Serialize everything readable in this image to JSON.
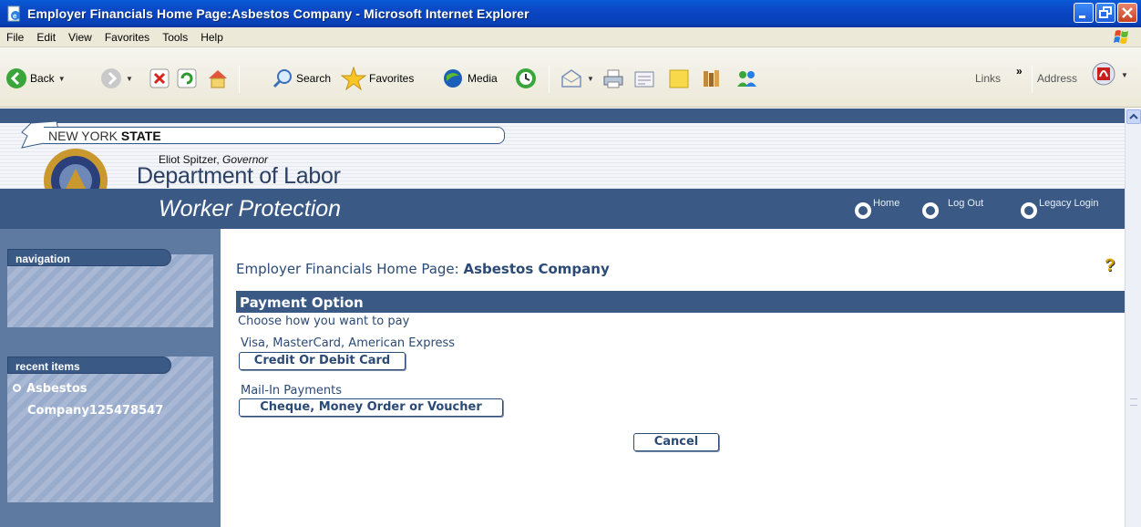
{
  "window": {
    "title": "Employer Financials Home Page:Asbestos Company - Microsoft Internet Explorer"
  },
  "menu": [
    "File",
    "Edit",
    "View",
    "Favorites",
    "Tools",
    "Help"
  ],
  "toolbar": {
    "back": "Back",
    "search": "Search",
    "favorites": "Favorites",
    "media": "Media",
    "links": "Links",
    "chevron": "»",
    "address": "Address"
  },
  "header": {
    "state_prefix": "NEW YORK ",
    "state_bold": "STATE",
    "governor_name": "Eliot Spitzer, ",
    "governor_title": "Governor",
    "department": "Department of Labor",
    "section": "Worker Protection",
    "links": [
      "Home",
      "Log Out",
      "Legacy Login"
    ]
  },
  "sidebar": {
    "navigation_label": "navigation",
    "recent_label": "recent items",
    "recent_items": [
      "Asbestos",
      "Company125478547"
    ]
  },
  "main": {
    "title_prefix": "Employer Financials Home Page:",
    "title_company": "Asbestos Company",
    "help": "?",
    "section_title": "Payment Option",
    "instruction": "Choose how you want to pay",
    "card_caption": "Visa, MasterCard, American Express",
    "card_button": "Credit Or Debit Card",
    "mail_caption": "Mail-In Payments",
    "mail_button": "Cheque, Money Order or Voucher",
    "cancel_button": "Cancel"
  },
  "colors": {
    "titlebar": "#0a46c4",
    "header_band": "#3a5a85",
    "text_blue": "#2b4a75"
  }
}
